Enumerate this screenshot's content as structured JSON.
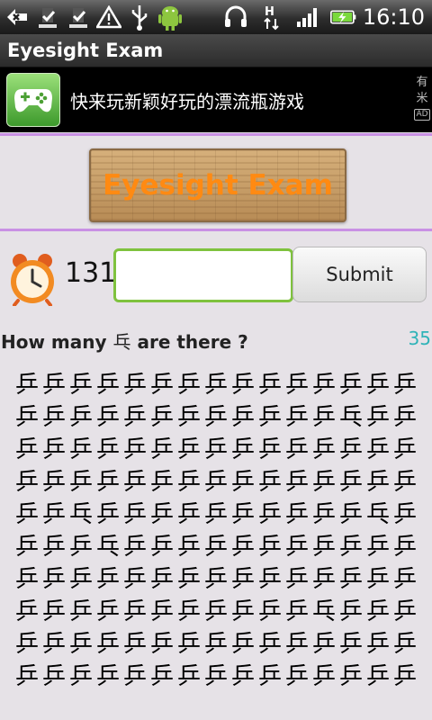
{
  "status_bar": {
    "time": "16:10",
    "icons": [
      "back-arrow-icon",
      "download-done-icon",
      "download-done-icon",
      "warning-icon",
      "usb-icon",
      "android-icon",
      "headset-icon",
      "signal-h-icon",
      "signal-bars-icon",
      "battery-charging-icon"
    ]
  },
  "app": {
    "title": "Eyesight Exam"
  },
  "ad": {
    "text": "快来玩新颖好玩的漂流瓶游戏",
    "badge_chars": [
      "有",
      "米",
      "AD"
    ]
  },
  "banner": {
    "text": "Eyesight Exam"
  },
  "timer": {
    "value": "131"
  },
  "answer": {
    "value": "",
    "placeholder": ""
  },
  "submit": {
    "label": "Submit"
  },
  "question": {
    "prefix": "How many ",
    "glyph": "乓",
    "suffix": " are there ?"
  },
  "count": "35",
  "grid": {
    "base_glyph": "乓",
    "rows": [
      "乒乒乒乒乒乒乒乒乒乒乒乒乒乒乒",
      "乒乒乒乒乒乒乒乒乒乒乒乒乓乒乒",
      "乒乒乒乒乒乒乒乒乒乒乒乒乒乒乒",
      "乒乒乒乒乒乒乒乒乒乒乒乒乒乒乒",
      "乒乒乓乒乒乒乒乒乒乒乒乒乒乓乒",
      "乒乒乒乓乒乒乒乒乒乒乒乒乒乒乒",
      "乒乒乒乒乒乒乒乒乒乒乒乒乒乒乒",
      "乒乒乒乒乒乒乒乒乒乒乒乓乒乒乒",
      "乒乒乒乒乒乒乒乒乒乒乒乒乒乒乒",
      "乒乒乒乒乒乒乒乒乒乒乒乒乒乒乒"
    ]
  },
  "colors": {
    "accent_purple": "#c990e4",
    "input_border": "#7fc23e",
    "count_color": "#2fb3b8",
    "banner_text": "#ff8a12"
  }
}
